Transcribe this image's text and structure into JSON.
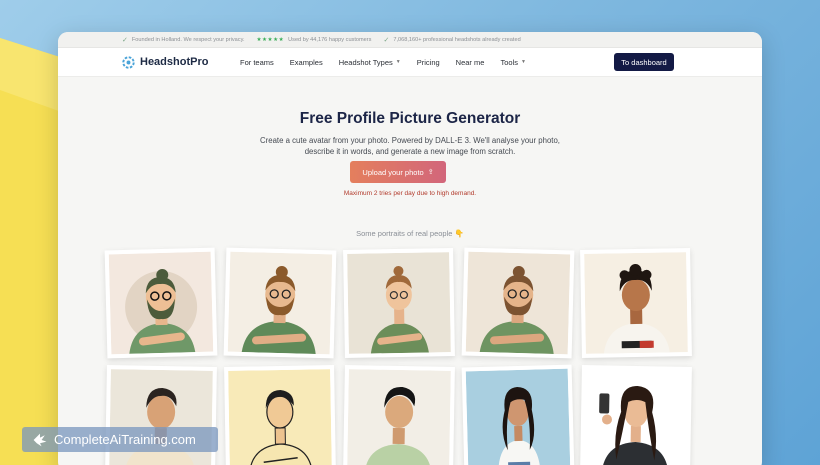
{
  "topbar": {
    "founded": "Founded in Holland. We respect your privacy.",
    "stars": "★★★★★",
    "rating": "Used by 44,176 happy customers",
    "headshots": "7,068,160+ professional headshots already created"
  },
  "navbar": {
    "brand": "HeadshotPro",
    "links": [
      "For teams",
      "Examples",
      "Headshot Types",
      "Pricing",
      "Near me",
      "Tools"
    ],
    "dashboard": "To dashboard"
  },
  "hero": {
    "title": "Free Profile Picture Generator",
    "description": "Create a cute avatar from your photo. Powered by DALL-E 3. We'll analyse your photo, describe it in words, and generate a new image from scratch.",
    "upload": "Upload your photo",
    "limit": "Maximum 2 tries per day due to high demand.",
    "portraits_label": "Some portraits of real people 👇"
  },
  "badge": {
    "text": "CompleteAiTraining.com"
  },
  "colors": {
    "navy": "#131a45",
    "accent": "#e47f5d",
    "warning": "#b23b2c"
  }
}
